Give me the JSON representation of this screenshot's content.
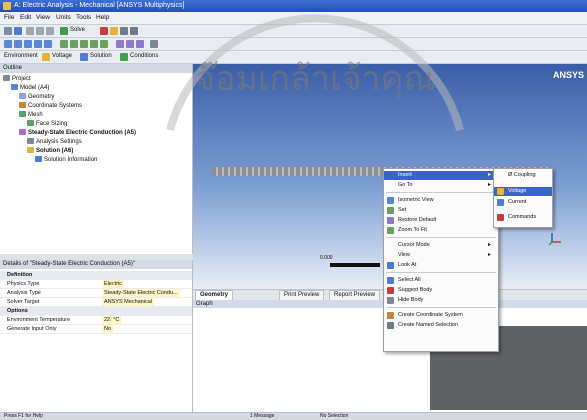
{
  "window": {
    "title": "A: Electric Analysis - Mechanical [ANSYS Multiphysics]"
  },
  "menu": [
    "File",
    "Edit",
    "View",
    "Units",
    "Tools",
    "Help"
  ],
  "toolbar": {
    "solve_label": "Solve",
    "environment_label": "Environment",
    "voltage_label": "Voltage",
    "solution_label": "Solution",
    "conditions_label": "Conditions"
  },
  "outline": {
    "header": "Outline",
    "items": [
      "Project",
      "Model (A4)",
      "Geometry",
      "Coordinate Systems",
      "Mesh",
      "Face Sizing",
      "Steady-State Electric Conduction (A5)",
      "Analysis Settings",
      "Solution (A6)",
      "Solution Information"
    ]
  },
  "details": {
    "header": "Details of \"Steady-State Electric Conduction (A5)\"",
    "rows": [
      {
        "key": "Definition",
        "value": "",
        "group": true
      },
      {
        "key": "Physics Type",
        "value": "Electric"
      },
      {
        "key": "Analysis Type",
        "value": "Steady-State Electric Condu..."
      },
      {
        "key": "Solver Target",
        "value": "ANSYS Mechanical"
      },
      {
        "key": "Options",
        "value": "",
        "group": true
      },
      {
        "key": "Environment Temperature",
        "value": "22. °C"
      },
      {
        "key": "Generate Input Only",
        "value": "No"
      }
    ]
  },
  "viewport": {
    "logo": "ANSYS",
    "scale_label": "0.000"
  },
  "tabs": [
    "Geometry",
    "Print Preview",
    "Report Preview"
  ],
  "graph": {
    "header": "Graph"
  },
  "context_menu": {
    "items": [
      "Insert",
      "Go To",
      "Isometric View",
      "Set",
      "Restore Default",
      "Zoom To Fit",
      "Cursor Mode",
      "View",
      "Look At",
      "Select All",
      "Suggest Body",
      "Hide Body",
      "Create Coordinate System",
      "Create Named Selection"
    ]
  },
  "submenu": {
    "items": [
      "Ø Coupling",
      "Voltage",
      "Current",
      "Commands"
    ]
  },
  "status": {
    "left": "Press F1 for Help",
    "middle": "1 Message",
    "right": "No Selection"
  },
  "watermark": {
    "text": "จ๊อมเกล้าเจ้าคุณ"
  },
  "colors": {
    "accent": "#3a65c4",
    "title_bar": "#2350b0",
    "viewport_top": "#3a5ea8"
  }
}
